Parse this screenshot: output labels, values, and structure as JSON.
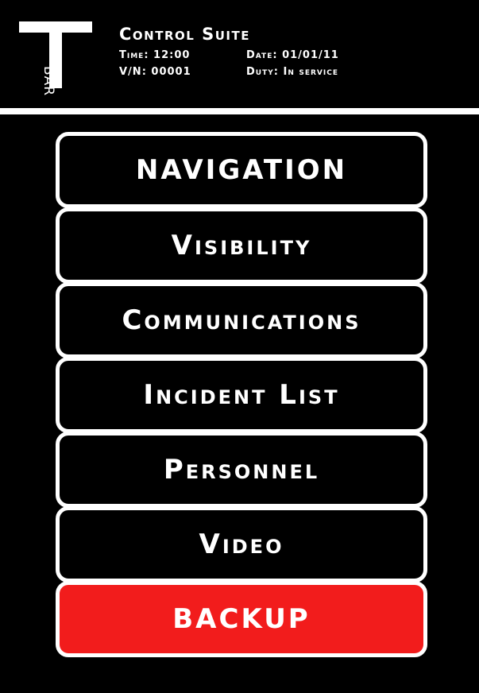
{
  "header": {
    "logo_text": "BAR",
    "title": "Control Suite",
    "time": "Time: 12:00",
    "date": "Date: 01/01/11",
    "vn": "V/N: 00001",
    "duty": "Duty: In service"
  },
  "menu": {
    "navigation": "NAVIGATION",
    "visibility": "Visibility",
    "communications": "Communications",
    "incident_list": "Incident List",
    "personnel": "Personnel",
    "video": "Video",
    "backup": "BACKUP"
  },
  "colors": {
    "background": "#000000",
    "foreground": "#ffffff",
    "backup_accent": "#f21c1c"
  }
}
